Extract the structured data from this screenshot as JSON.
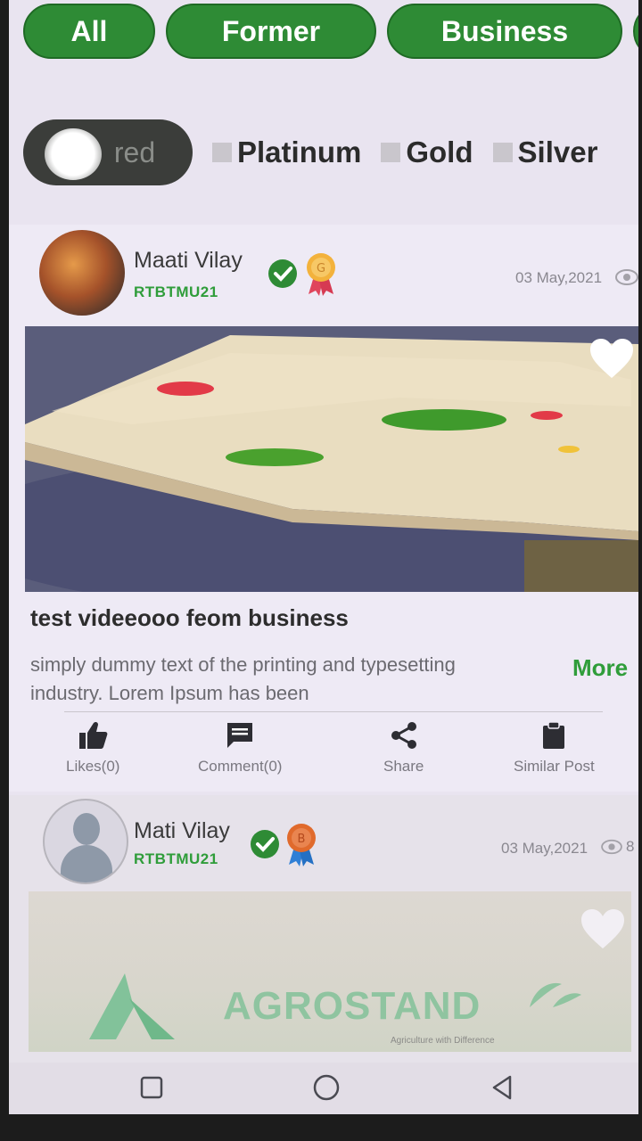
{
  "category_tabs": [
    "All",
    "Former",
    "Business"
  ],
  "membership_filters": {
    "featured_label": "red",
    "options": [
      "Platinum",
      "Gold",
      "Silver"
    ]
  },
  "posts": [
    {
      "author": "Maati Vilay",
      "code": "RTBTMU21",
      "date": "03 May,2021",
      "title": "test videeooo feom business",
      "description": "simply dummy text of the printing and typesetting industry. Lorem Ipsum has been",
      "more_label": "More",
      "actions": {
        "likes": "Likes(0)",
        "comment": "Comment(0)",
        "share": "Share",
        "similar": "Similar Post"
      },
      "medal_letter": "G"
    },
    {
      "author": "Mati Vilay",
      "code": "RTBTMU21",
      "date": "03 May,2021",
      "views": "8",
      "brand": "AGROSTAND",
      "tagline": "Agriculture with Difference",
      "medal_letter": "B"
    }
  ],
  "colors": {
    "accent_green": "#2e8b35",
    "code_green": "#2f9d3a",
    "background": "#e9e4f0"
  },
  "icons": {
    "verified": "verified-check-icon",
    "medal": "medal-icon",
    "heart": "heart-icon",
    "eye": "eye-icon",
    "like": "thumbs-up-icon",
    "comment": "comment-icon",
    "share": "share-icon",
    "similar": "clipboard-icon"
  }
}
